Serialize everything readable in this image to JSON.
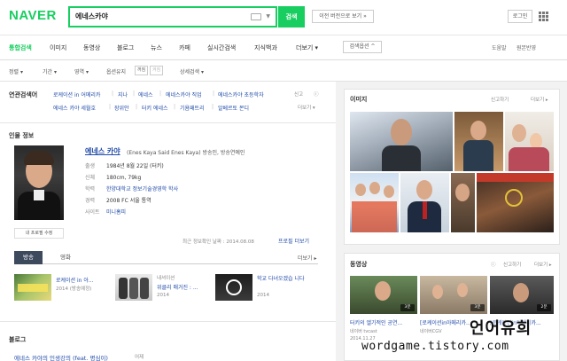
{
  "header": {
    "logo": "NAVER",
    "search_value": "에네스카야",
    "search_button": "검색",
    "prev_version": "이전 버전으로 보기 »",
    "login": "로그인"
  },
  "tabs": {
    "items": [
      "통합검색",
      "이미지",
      "동영상",
      "블로그",
      "뉴스",
      "카페",
      "실시간검색",
      "지식백과",
      "더보기 ▾"
    ],
    "search_options": "검색옵션 ^",
    "help": "도움말",
    "report": "원본반영"
  },
  "options": {
    "sort": "정렬 ▾",
    "period": "기간 ▾",
    "area": "영역 ▾",
    "option_reset": "옵션유지",
    "toggle_on": "꺼짐",
    "toggle_off": "켜짐",
    "detail": "상세검색 ▾"
  },
  "related": {
    "label": "연관검색어",
    "row1": [
      "로케이션 in 어메리카",
      "지나",
      "에네스",
      "에네스카야 직업",
      "에네스카야 초등학자"
    ],
    "row2": [
      "에네스 카야 세월호",
      "장위안",
      "터키 에네스",
      "기욤패트리",
      "알베르토 몬디"
    ],
    "tools": "신고",
    "more": "더보기 ▾"
  },
  "person": {
    "section_title": "인물 정보",
    "name": "에네스 카야",
    "name_sub": "(Enes Kaya    Said Enes Kaya)  방송인, 방송연예인",
    "rows": [
      {
        "key": "출생",
        "val": "1984년 8월 22일 (터키)"
      },
      {
        "key": "신체",
        "val": "180cm, 79kg"
      },
      {
        "key": "학력",
        "val": "한양대학교 정보기술경영학 학사"
      },
      {
        "key": "경력",
        "val": "2008 FC 서울 통역"
      },
      {
        "key": "사이트",
        "val": "미니홈피"
      }
    ],
    "photo_caption": "내 프로필 수정",
    "updated": "최근 정보확인 날짜 : 2014.08.08",
    "more_info": "프로필 더보기"
  },
  "works": {
    "tab_active": "방송",
    "tab_inactive": "영화",
    "more": "더보기 ▸",
    "items": [
      {
        "title": "로케이션 in 아...",
        "meta": "2014 (방송예정)"
      },
      {
        "title": "위클리 매거진 : ...",
        "meta": "2014",
        "channel": "내셔이션"
      },
      {
        "title": "학교 다녀오겠습 니다",
        "meta": "2014"
      }
    ]
  },
  "blog": {
    "section_title": "블로그",
    "post_title": "에네스 카야의 인생강의 (feat. 명심이)",
    "post_meta": "어제"
  },
  "side": {
    "images_title": "이미지",
    "images_tools": "신고하기",
    "images_more": "더보기 ▸",
    "videos_title": "동영상",
    "videos_tools": "신고하기",
    "videos_more": "더보기 ▸",
    "videos": [
      {
        "title": "터키의 엘기적인 공연...",
        "meta": "네이버 tvcast",
        "date": "2014.11.27",
        "dur": "3분"
      },
      {
        "title": "[로케이션in아메리카...",
        "meta": "네이버CGV",
        "date": "",
        "dur": "3분"
      },
      {
        "title": "[로케이션in아메리카...",
        "meta": "",
        "date": "",
        "dur": "2분"
      }
    ]
  },
  "watermark": {
    "korean": "언어유희",
    "url": "wordgame.tistory.com"
  }
}
